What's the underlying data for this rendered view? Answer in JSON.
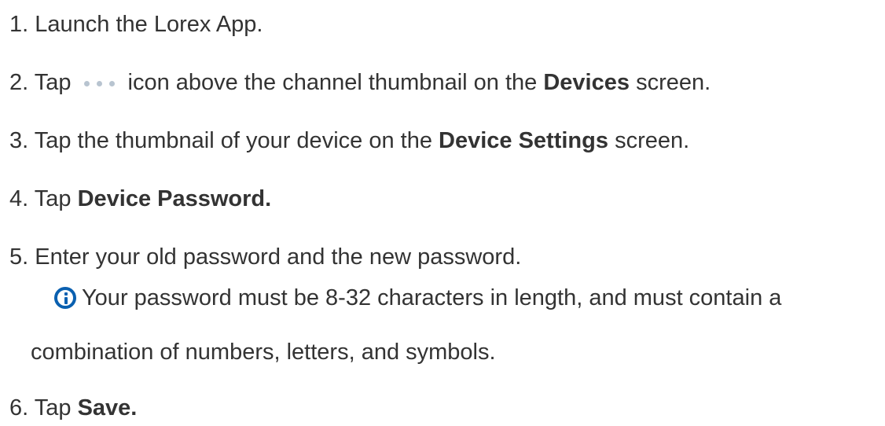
{
  "steps": [
    {
      "num": "1.",
      "text": "Launch the Lorex App."
    },
    {
      "num": "2.",
      "pre": "Tap",
      "post": "icon above the channel thumbnail on the",
      "bold": "Devices",
      "tail": "screen."
    },
    {
      "num": "3.",
      "pre": "Tap the thumbnail of your device on the",
      "bold": "Device Settings",
      "tail": "screen."
    },
    {
      "num": "4.",
      "pre": "Tap",
      "bold": "Device Password."
    },
    {
      "num": "5.",
      "text": "Enter your old password and the new password."
    },
    {
      "num": "6.",
      "pre": "Tap",
      "bold": "Save."
    }
  ],
  "note": {
    "line1": "Your password must be 8-32 characters in length, and must contain a",
    "line2": "combination of numbers, letters, and symbols."
  },
  "icons": {
    "more": "more-dots-icon",
    "info": "info-icon",
    "info_color": "#0a60b0"
  }
}
